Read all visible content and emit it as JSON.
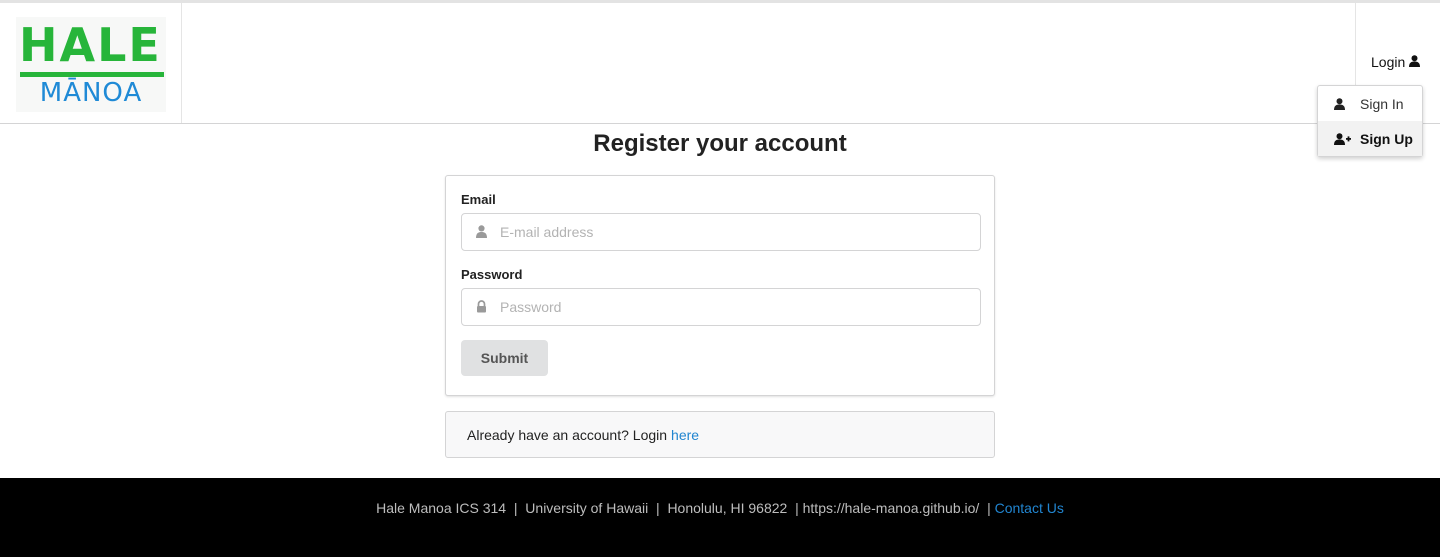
{
  "logo": {
    "top_text": "HALE",
    "bottom_text": "MĀNOA",
    "green": "#27b53a",
    "blue": "#1f8ad6"
  },
  "nav": {
    "login_label": "Login",
    "login_icon": "user-icon",
    "dropdown": [
      {
        "label": "Sign In",
        "icon": "user-icon"
      },
      {
        "label": "Sign Up",
        "icon": "user-plus-icon",
        "active": true
      }
    ]
  },
  "page": {
    "title": "Register your account"
  },
  "form": {
    "email_label": "Email",
    "email_placeholder": "E-mail address",
    "email_value": "",
    "password_label": "Password",
    "password_placeholder": "Password",
    "password_value": "",
    "submit_label": "Submit"
  },
  "message": {
    "text": "Already have an account? Login",
    "link_label": "here",
    "link_color": "#2185d0"
  },
  "footer": {
    "org": "Hale Manoa ICS 314",
    "university": "University of Hawaii",
    "location": "Honolulu, HI 96822",
    "url": "https://hale-manoa.github.io/",
    "contact_label": "Contact Us",
    "separator": "|"
  }
}
